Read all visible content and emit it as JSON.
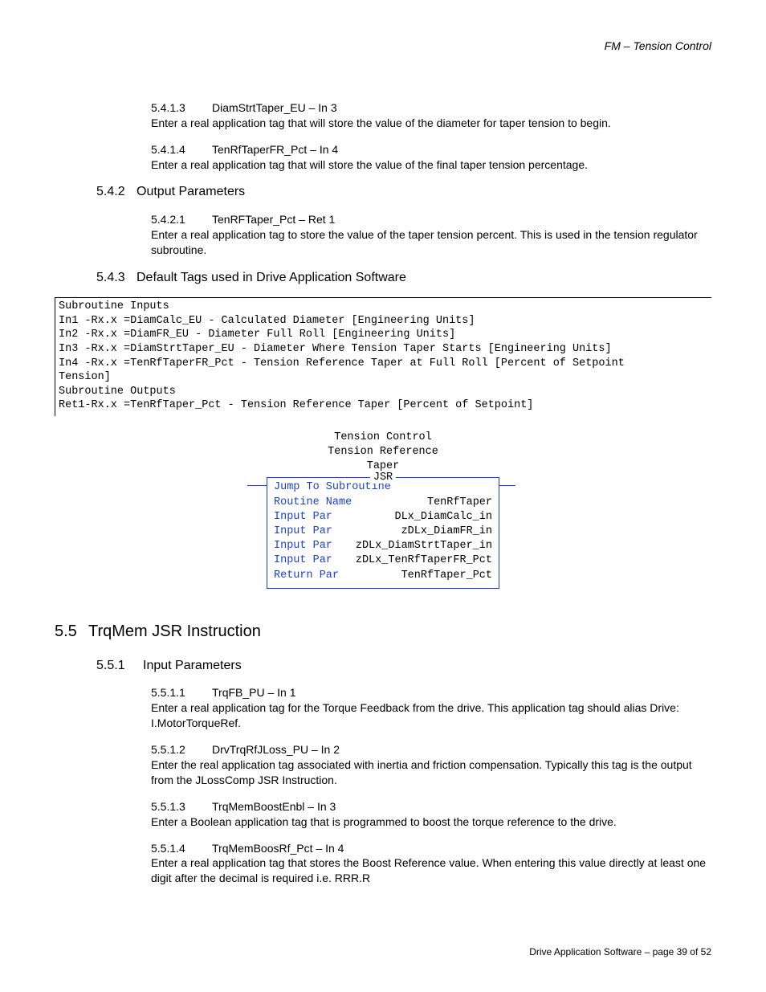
{
  "running_head": "FM – Tension Control",
  "sec_5_4_1_3": {
    "num": "5.4.1.3",
    "title": "DiamStrtTaper_EU – In 3",
    "body": "Enter a real application tag that will store the value of the diameter for taper tension to begin."
  },
  "sec_5_4_1_4": {
    "num": "5.4.1.4",
    "title": "TenRfTaperFR_Pct – In 4",
    "body": "Enter a real application tag that will store the value of the final taper tension percentage."
  },
  "h_5_4_2": {
    "num": "5.4.2",
    "title": "Output Parameters"
  },
  "sec_5_4_2_1": {
    "num": "5.4.2.1",
    "title": "TenRFTaper_Pct – Ret 1",
    "body": "Enter a real application tag to store the value of the taper tension percent.  This is used in the tension regulator subroutine."
  },
  "h_5_4_3": {
    "num": "5.4.3",
    "title": "Default Tags used in Drive Application Software"
  },
  "code_block": "Subroutine Inputs\nIn1 -Rx.x =DiamCalc_EU - Calculated Diameter [Engineering Units]\nIn2 -Rx.x =DiamFR_EU - Diameter Full Roll [Engineering Units]\nIn3 -Rx.x =DiamStrtTaper_EU - Diameter Where Tension Taper Starts [Engineering Units]\nIn4 -Rx.x =TenRfTaperFR_Pct - Tension Reference Taper at Full Roll [Percent of Setpoint\nTension]\nSubroutine Outputs\nRet1-Rx.x =TenRfTaper_Pct - Tension Reference Taper [Percent of Setpoint]",
  "jsr": {
    "line1": "Tension Control",
    "line2": "Tension Reference",
    "line3": "Taper",
    "header": "JSR",
    "first_line": "Jump To Subroutine",
    "rows": [
      {
        "l": "Routine Name",
        "r": "TenRfTaper"
      },
      {
        "l": "Input Par",
        "r": "DLx_DiamCalc_in"
      },
      {
        "l": "Input Par",
        "r": "zDLx_DiamFR_in"
      },
      {
        "l": "Input Par",
        "r": "zDLx_DiamStrtTaper_in"
      },
      {
        "l": "Input Par",
        "r": "zDLx_TenRfTaperFR_Pct"
      },
      {
        "l": "Return Par",
        "r": "TenRfTaper_Pct"
      }
    ]
  },
  "h_5_5": {
    "num": "5.5",
    "title": "TrqMem JSR Instruction"
  },
  "h_5_5_1": {
    "num": "5.5.1",
    "title": "Input Parameters"
  },
  "sec_5_5_1_1": {
    "num": "5.5.1.1",
    "title": "TrqFB_PU – In 1",
    "body": "Enter a real application tag for the Torque Feedback from the drive.  This application tag should alias Drive: I.MotorTorqueRef."
  },
  "sec_5_5_1_2": {
    "num": "5.5.1.2",
    "title": "DrvTrqRfJLoss_PU – In 2",
    "body": "Enter the real application tag associated with inertia and friction compensation.  Typically this tag is the output from the JLossComp JSR Instruction."
  },
  "sec_5_5_1_3": {
    "num": "5.5.1.3",
    "title": "TrqMemBoostEnbl – In 3",
    "body": "Enter a Boolean application tag that is programmed to boost the torque reference to the drive."
  },
  "sec_5_5_1_4": {
    "num": "5.5.1.4",
    "title": "TrqMemBoosRf_Pct – In 4",
    "body": "Enter a real application tag that stores the Boost Reference value.  When entering this value directly at least one digit after the decimal is required i.e.  RRR.R"
  },
  "footer": "Drive Application Software – page 39 of 52"
}
